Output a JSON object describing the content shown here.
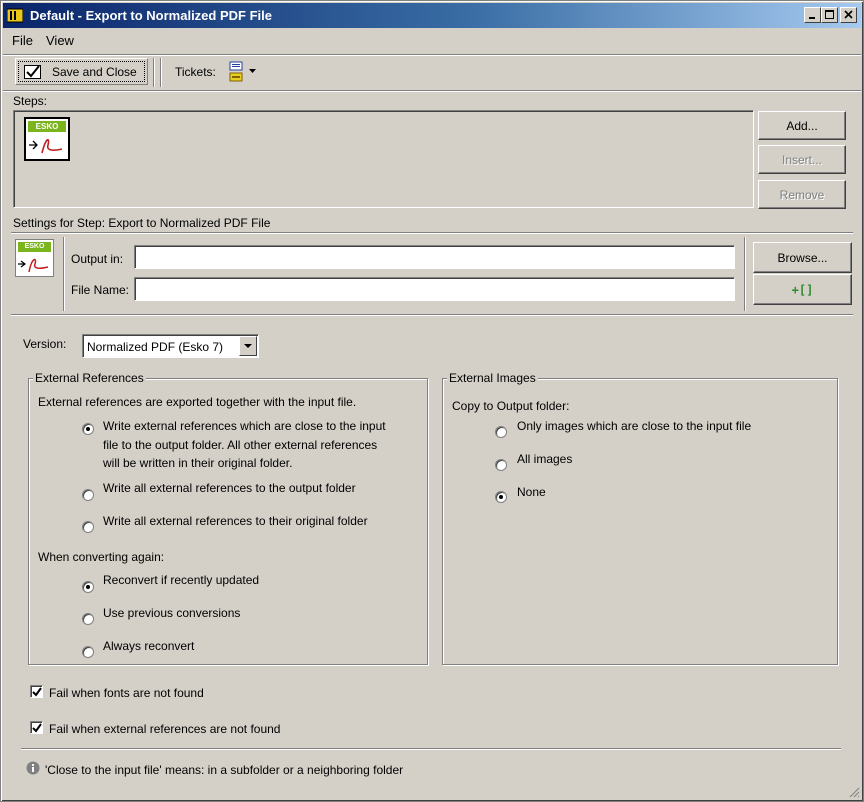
{
  "window": {
    "title": "Default - Export to Normalized PDF File"
  },
  "menu": {
    "file": "File",
    "view": "View"
  },
  "toolbar": {
    "save_close": "Save and Close",
    "tickets": "Tickets:"
  },
  "steps": {
    "label": "Steps:",
    "step_icon_badge": "ESKO",
    "add": "Add...",
    "insert": "Insert...",
    "remove": "Remove"
  },
  "settings": {
    "title": "Settings for Step: Export to Normalized PDF File",
    "icon_badge": "ESKO",
    "output_in_label": "Output in:",
    "output_in_value": "",
    "file_name_label": "File Name:",
    "file_name_value": "",
    "browse": "Browse...",
    "add_token": "+[]"
  },
  "version": {
    "label": "Version:",
    "selected": "Normalized PDF (Esko 7)"
  },
  "external_references": {
    "title": "External References",
    "intro": "External references are exported together with the input file.",
    "options": [
      {
        "lines": [
          "Write external references which are close to the input",
          "file to the output folder. All other external references",
          "will be written in their original folder."
        ],
        "selected": true
      },
      {
        "lines": [
          "Write all external references to the output folder"
        ],
        "selected": false
      },
      {
        "lines": [
          "Write all external references to their original folder"
        ],
        "selected": false
      }
    ],
    "converting_label": "When converting again:",
    "convert_options": [
      {
        "label": "Reconvert if recently updated",
        "selected": true
      },
      {
        "label": "Use previous conversions",
        "selected": false
      },
      {
        "label": "Always reconvert",
        "selected": false
      }
    ]
  },
  "external_images": {
    "title": "External Images",
    "intro": "Copy to Output folder:",
    "options": [
      {
        "label": "Only images which are close to the input file",
        "selected": false
      },
      {
        "label": "All images",
        "selected": false
      },
      {
        "label": "None",
        "selected": true
      }
    ]
  },
  "checks": {
    "fonts": {
      "label": "Fail when fonts are not found",
      "checked": true
    },
    "refs": {
      "label": "Fail when external references are not found",
      "checked": true
    }
  },
  "info": {
    "text": "'Close to the input file' means: in a subfolder or a neighboring folder"
  },
  "colors": {
    "titlebar_start": "#0a246a",
    "esko_green": "#7ab51d",
    "token_green": "#2e8b2e"
  }
}
